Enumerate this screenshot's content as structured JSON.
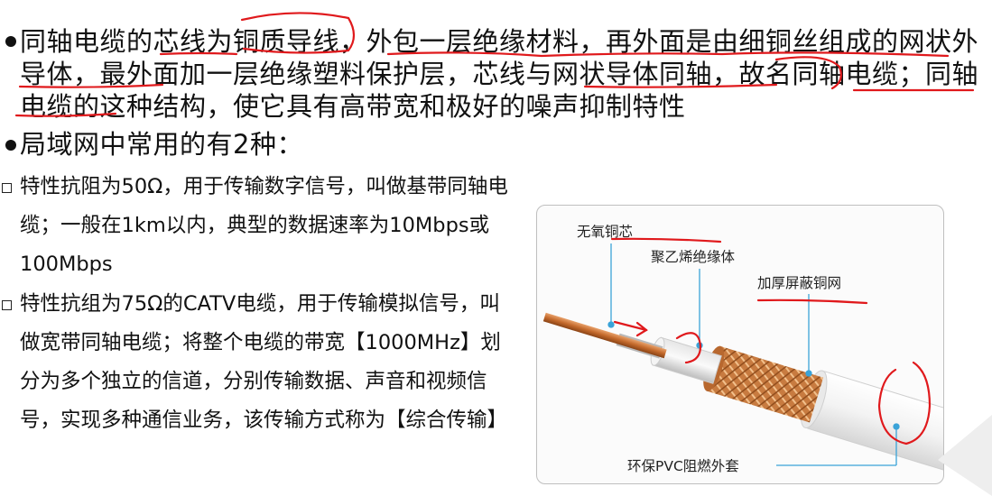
{
  "bullet1": {
    "text": "同轴电缆的芯线为铜质导线，外包一层绝缘材料，再外面是由细铜丝组成的网状外导体，最外面加一层绝缘塑料保护层，芯线与网状导体同轴，故名同轴电缆；同轴电缆的这种结构，使它具有高带宽和极好的噪声抑制特性"
  },
  "bullet2": {
    "text": "局域网中常用的有2种："
  },
  "sub1": {
    "text": "特性抗阻为50Ω，用于传输数字信号，叫做基带同轴电缆；一般在1km以内，典型的数据速率为10Mbps或100Mbps"
  },
  "sub2": {
    "text": "特性抗组为75Ω的CATV电缆，用于传输模拟信号，叫做宽带同轴电缆；将整个电缆的带宽【1000MHz】划分为多个独立的信道，分别传输数据、声音和视频信号，实现多种通信业务，该传输方式称为【综合传输】"
  },
  "figure": {
    "label_core": "无氧铜芯",
    "label_insulation": "聚乙烯绝缘体",
    "label_shield": "加厚屏蔽铜网",
    "label_jacket": "环保PVC阻燃外套"
  },
  "colors": {
    "annotation": "#e0191c",
    "pointer": "#3aa3d8",
    "copper": "#c8783e",
    "text": "#111111"
  }
}
